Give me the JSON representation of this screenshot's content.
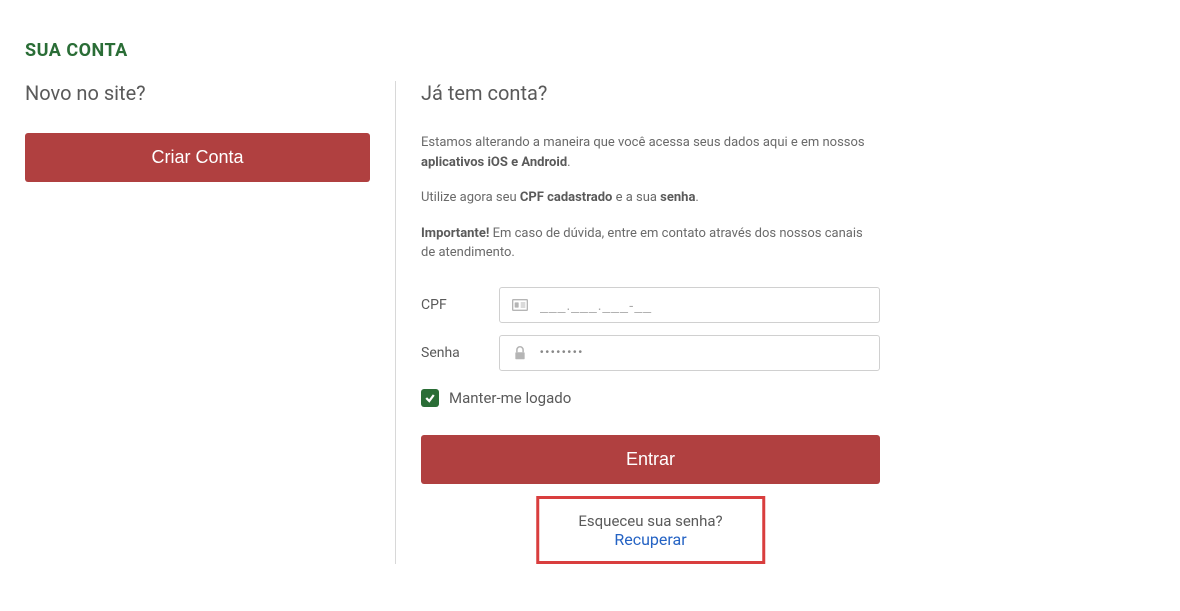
{
  "page": {
    "title": "SUA CONTA"
  },
  "left": {
    "heading": "Novo no site?",
    "create_button": "Criar Conta"
  },
  "right": {
    "heading": "Já tem conta?",
    "info1_part1": "Estamos alterando a maneira que você acessa seus dados aqui e em nossos ",
    "info1_bold": "aplicativos iOS e Android",
    "info1_part2": ".",
    "info2_part1": "Utilize agora seu ",
    "info2_bold1": "CPF cadastrado",
    "info2_part2": " e a sua ",
    "info2_bold2": "senha",
    "info2_part3": ".",
    "info3_bold": "Importante!",
    "info3_text": " Em caso de dúvida, entre em contato através dos nossos canais de atendimento.",
    "cpf_label": "CPF",
    "cpf_placeholder": "___.___.___-__",
    "senha_label": "Senha",
    "senha_value": "●●●●●●●●",
    "remember_label": "Manter-me logado",
    "login_button": "Entrar",
    "recover_text": "Esqueceu sua senha? ",
    "recover_link": "Recuperar"
  }
}
